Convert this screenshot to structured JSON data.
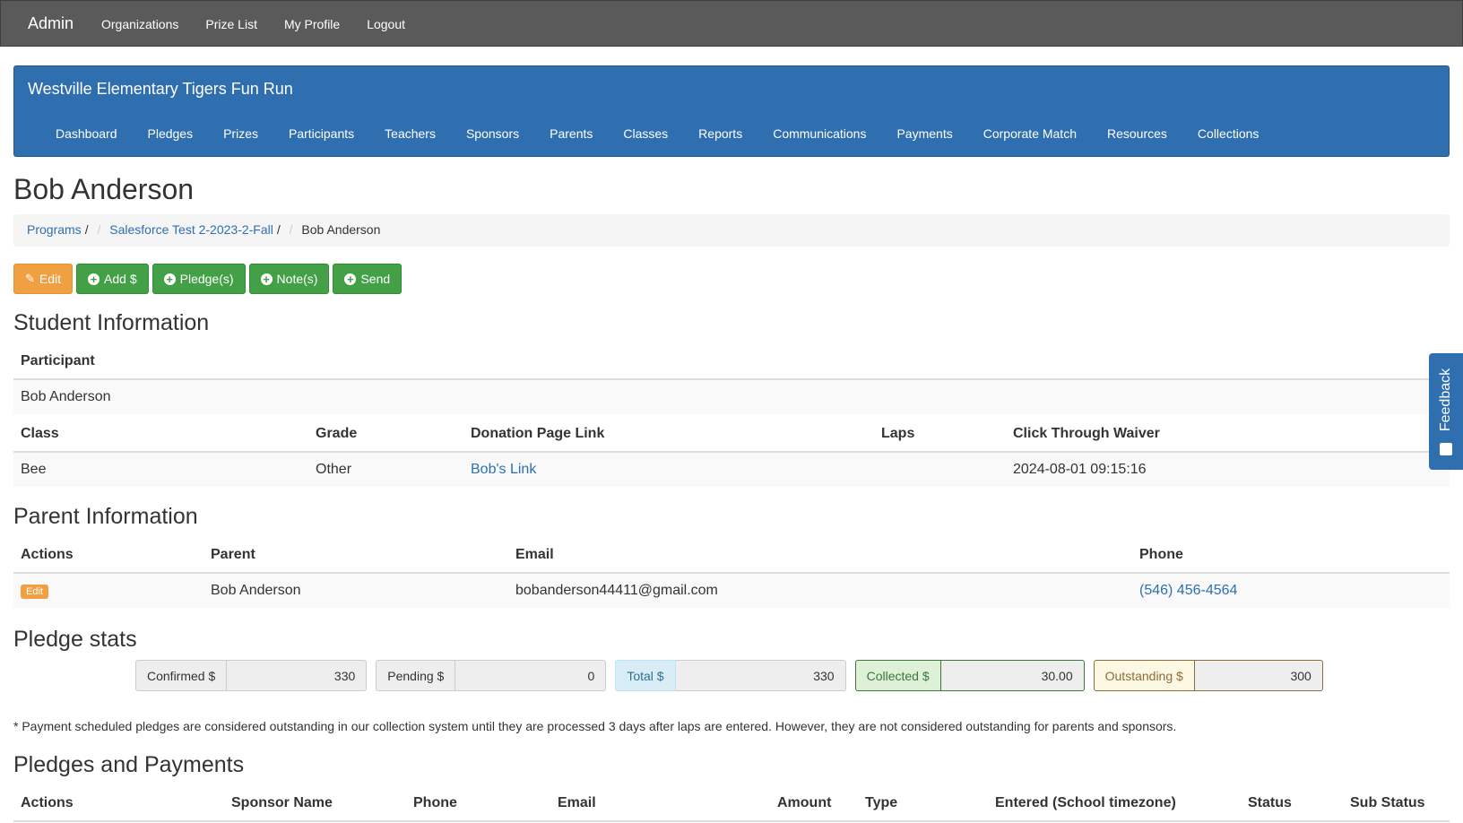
{
  "topnav": {
    "brand": "Admin",
    "links": [
      "Organizations",
      "Prize List",
      "My Profile",
      "Logout"
    ]
  },
  "org": {
    "title": "Westville Elementary Tigers Fun Run",
    "nav": [
      "Dashboard",
      "Pledges",
      "Prizes",
      "Participants",
      "Teachers",
      "Sponsors",
      "Parents",
      "Classes",
      "Reports",
      "Communications",
      "Payments",
      "Corporate Match",
      "Resources",
      "Collections"
    ]
  },
  "page_title": "Bob Anderson",
  "breadcrumb": {
    "programs": "Programs",
    "program": "Salesforce Test 2-2023-2-Fall",
    "current": "Bob Anderson"
  },
  "actions": {
    "edit": "Edit",
    "add": "Add $",
    "pledges": "Pledge(s)",
    "notes": "Note(s)",
    "send": "Send"
  },
  "student": {
    "heading": "Student Information",
    "participant_header": "Participant",
    "participant": "Bob Anderson",
    "headers": [
      "Class",
      "Grade",
      "Donation Page Link",
      "Laps",
      "Click Through Waiver"
    ],
    "row": {
      "class": "Bee",
      "grade": "Other",
      "link": "Bob's Link",
      "laps": "",
      "waiver": "2024-08-01 09:15:16"
    }
  },
  "parent": {
    "heading": "Parent Information",
    "headers": [
      "Actions",
      "Parent",
      "Email",
      "Phone"
    ],
    "row": {
      "action": "Edit",
      "name": "Bob Anderson",
      "email": "bobanderson44411@gmail.com",
      "phone": "(546) 456-4564"
    }
  },
  "stats": {
    "heading": "Pledge stats",
    "confirmed_label": "Confirmed $",
    "confirmed": "330",
    "pending_label": "Pending $",
    "pending": "0",
    "total_label": "Total $",
    "total": "330",
    "collected_label": "Collected $",
    "collected": "30.00",
    "outstanding_label": "Outstanding $",
    "outstanding": "300",
    "colors": {
      "total": "#d9edf7",
      "collected": "#dff0d8",
      "outstanding": "#fcf8e3"
    }
  },
  "note": "* Payment scheduled pledges are considered outstanding in our collection system until they are processed 3 days after laps are entered. However, they are not considered outstanding for parents and sponsors.",
  "pledges": {
    "heading": "Pledges and Payments",
    "headers": [
      "Actions",
      "Sponsor Name",
      "Phone",
      "Email",
      "Amount",
      "Type",
      "Entered (School timezone)",
      "Status",
      "Sub Status"
    ]
  },
  "feedback": "Feedback",
  "colors": {
    "topbar": "#5a5a5a",
    "brand_blue": "#2f6fb0",
    "edit_orange": "#f0a040",
    "action_green": "#43a047"
  }
}
